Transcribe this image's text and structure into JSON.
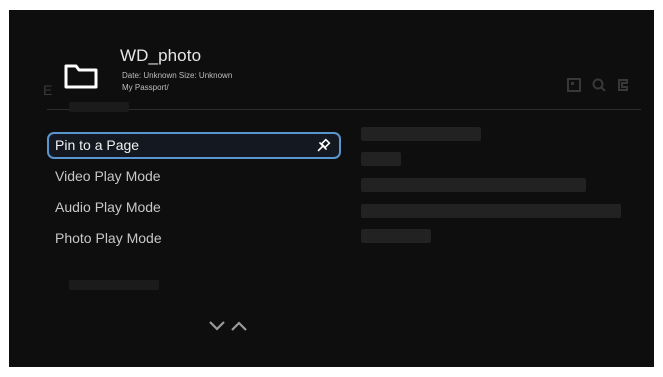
{
  "header": {
    "title": "WD_photo",
    "meta_line": "Date: Unknown Size: Unknown",
    "path": "My Passport/"
  },
  "menu": {
    "items": [
      {
        "label": "Pin to a Page",
        "selected": true,
        "icon": "pin-icon"
      },
      {
        "label": "Video Play Mode",
        "selected": false
      },
      {
        "label": "Audio Play Mode",
        "selected": false
      },
      {
        "label": "Photo Play Mode",
        "selected": false
      }
    ]
  },
  "navigation": {
    "icon": "down-up-arrows-icon"
  },
  "background_toolbar": {
    "icons": [
      "grid-icon",
      "search-icon",
      "settings-icon"
    ]
  },
  "colors": {
    "screen_bg": "#0e0e0e",
    "selection_border": "#5b95cf",
    "text_primary": "#e6e6e6",
    "text_secondary": "#c7c7c7"
  }
}
